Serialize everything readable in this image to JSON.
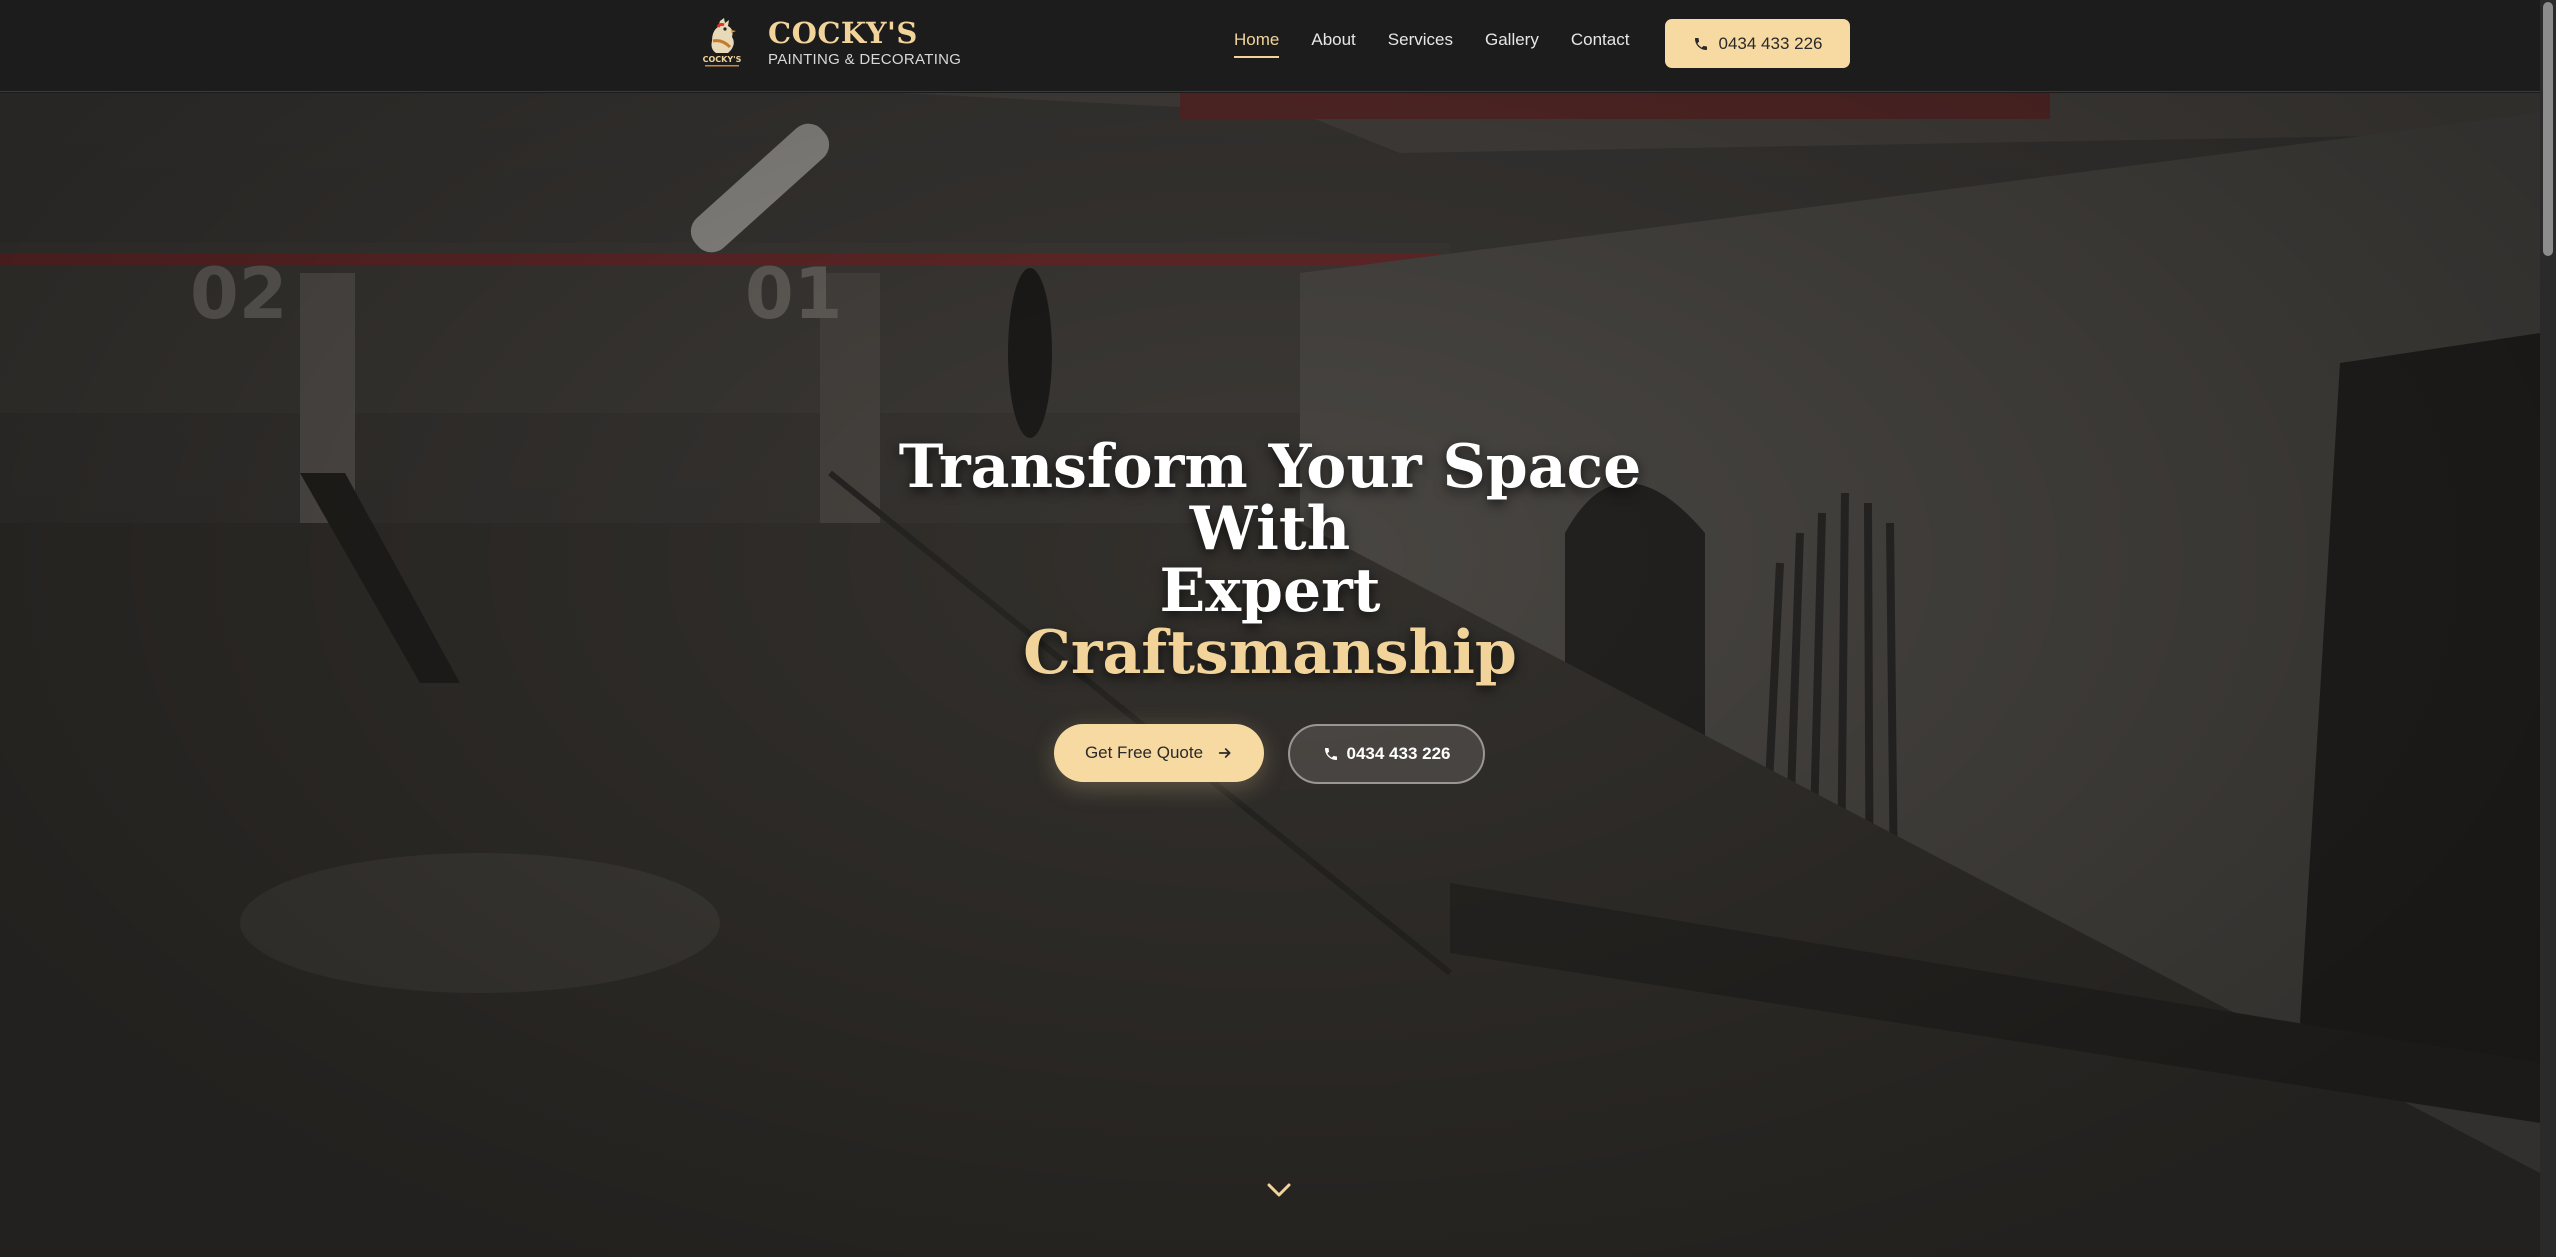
{
  "brand": {
    "name": "COCKY'S",
    "tagline": "PAINTING & DECORATING",
    "logo_text": "COCKY'S",
    "accent_color": "#f2d49b"
  },
  "nav": {
    "items": [
      {
        "label": "Home",
        "active": true
      },
      {
        "label": "About",
        "active": false
      },
      {
        "label": "Services",
        "active": false
      },
      {
        "label": "Gallery",
        "active": false
      },
      {
        "label": "Contact",
        "active": false
      }
    ],
    "call_label": "0434 433 226",
    "call_icon": "phone-icon"
  },
  "hero": {
    "title_line1": "Transform Your Space",
    "title_line2": "With",
    "title_line3": "Expert",
    "title_accent": "Craftsmanship",
    "quote_label": "Get Free Quote",
    "quote_icon": "arrow-right-icon",
    "phone_label": "0434 433 226",
    "phone_icon": "phone-icon",
    "scroll_icon": "chevron-down-icon",
    "background_scene": {
      "parking_numbers": [
        "02",
        "01"
      ]
    }
  },
  "colors": {
    "header_bg": "#1c1c1c",
    "button_bg": "#f7d9a2",
    "text_light": "#ffffff"
  }
}
